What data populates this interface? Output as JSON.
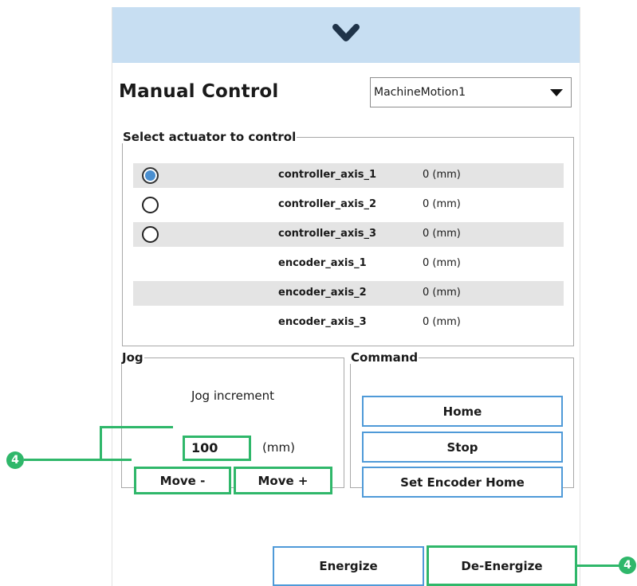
{
  "header": {
    "collapse_icon": "chevron-down-icon"
  },
  "title": "Manual Control",
  "machine_select": {
    "value": "MachineMotion1",
    "icon": "triangle-down-icon"
  },
  "actuator_group": {
    "legend": "Select actuator to control",
    "rows": [
      {
        "name": "controller_axis_1",
        "value": "0 (mm)",
        "radio": "selected"
      },
      {
        "name": "controller_axis_2",
        "value": "0 (mm)",
        "radio": "unselected"
      },
      {
        "name": "controller_axis_3",
        "value": "0 (mm)",
        "radio": "unselected"
      },
      {
        "name": "encoder_axis_1",
        "value": "0 (mm)",
        "radio": "none"
      },
      {
        "name": "encoder_axis_2",
        "value": "0 (mm)",
        "radio": "none"
      },
      {
        "name": "encoder_axis_3",
        "value": "0 (mm)",
        "radio": "none"
      }
    ]
  },
  "jog": {
    "legend": "Jog",
    "increment_label": "Jog increment",
    "increment_value": "100",
    "unit": "(mm)",
    "move_minus": "Move -",
    "move_plus": "Move +"
  },
  "command": {
    "legend": "Command",
    "home": "Home",
    "stop": "Stop",
    "set_encoder_home": "Set Encoder Home"
  },
  "footer": {
    "energize": "Energize",
    "de_energize": "De-Energize"
  },
  "callouts": [
    "4",
    "4"
  ],
  "colors": {
    "header": "#c7def2",
    "button_border": "#4f9ad8",
    "highlight": "#2fb76a",
    "radio_selected": "#4a8fd0",
    "row_shade": "#e4e4e4"
  }
}
